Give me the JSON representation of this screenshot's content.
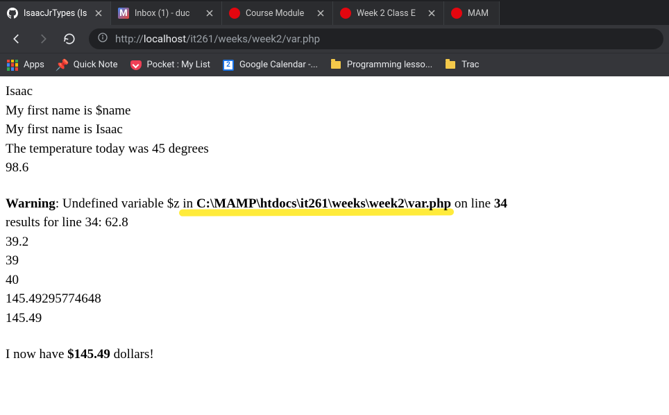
{
  "tabs": [
    {
      "title": "IsaacJrTypes (Is"
    },
    {
      "title": "Inbox (1) - duc"
    },
    {
      "title": "Course Module"
    },
    {
      "title": "Week 2 Class E"
    },
    {
      "title": "MAM"
    }
  ],
  "url": {
    "scheme": "http://",
    "host": "localhost",
    "path": "/it261/weeks/week2/var.php"
  },
  "bookmarks": [
    {
      "label": "Apps"
    },
    {
      "label": "Quick Note"
    },
    {
      "label": "Pocket : My List"
    },
    {
      "label": "Google Calendar -..."
    },
    {
      "gcal_day": "2"
    },
    {
      "label": "Programming lesso..."
    },
    {
      "label": "Trac"
    }
  ],
  "content": {
    "line1": "Isaac",
    "line2": "My first name is $name",
    "line3": "My first name is Isaac",
    "line4": "The temperature today was 45 degrees",
    "line5": "98.6",
    "warn_label": "Warning",
    "warn_mid": ": Undefined variable $z in ",
    "warn_path": "C:\\MAMP\\htdocs\\it261\\weeks\\week2\\var.php",
    "warn_online": " on line ",
    "warn_lineno": "34",
    "line7": "results for line 34: 62.8",
    "line8": "39.2",
    "line9": "39",
    "line10": "40",
    "line11": "145.49295774648",
    "line12": "145.49",
    "final_pre": "I now have ",
    "final_amt": "$145.49",
    "final_post": " dollars!"
  }
}
